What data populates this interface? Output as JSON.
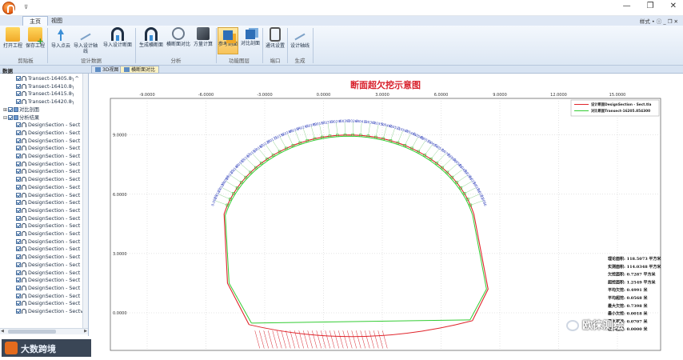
{
  "titlebar": {
    "qa_text": "⊽",
    "minimize": "—",
    "restore": "❐",
    "close": "✕"
  },
  "tabs": [
    {
      "label": "主页"
    },
    {
      "label": "视图"
    }
  ],
  "tab_right": "样式 • ⓘ _ ❐ ✕",
  "ribbon": {
    "buttons": [
      {
        "label": "打开工程"
      },
      {
        "label": "保存工程"
      },
      {
        "label": "导入点云"
      },
      {
        "label": "导入设计轴线"
      },
      {
        "label": "导入设计断面"
      },
      {
        "label": "生成横断面"
      },
      {
        "label": "横断面对比"
      },
      {
        "label": "方量计算"
      },
      {
        "label": "参考剖面"
      },
      {
        "label": "对比剖面"
      },
      {
        "label": "通讯设置"
      },
      {
        "label": "设计轴线"
      }
    ],
    "groups": [
      {
        "label": "剪贴板"
      },
      {
        "label": "设计数据"
      },
      {
        "label": "分析"
      },
      {
        "label": "功能图层"
      },
      {
        "label": "端口"
      },
      {
        "label": "生成"
      }
    ]
  },
  "panel": {
    "title": "数据"
  },
  "doc_tabs": [
    {
      "label": "3D视图"
    },
    {
      "label": "横断面对比"
    }
  ],
  "tree": {
    "items": [
      {
        "label": "Transect-16405.8╮^"
      },
      {
        "label": "Transect-16410.8╮"
      },
      {
        "label": "Transect-16415.8╮"
      },
      {
        "label": "Transect-16420.8╮"
      },
      {
        "label": "对比剖面"
      },
      {
        "label": "分析结果"
      },
      {
        "label": "DesignSection - Sect"
      },
      {
        "label": "DesignSection - Sect"
      },
      {
        "label": "DesignSection - Sect"
      },
      {
        "label": "DesignSection - Sect"
      },
      {
        "label": "DesignSection - Sect"
      },
      {
        "label": "DesignSection - Sect"
      },
      {
        "label": "DesignSection - Sect"
      },
      {
        "label": "DesignSection - Sect"
      },
      {
        "label": "DesignSection - Sect"
      },
      {
        "label": "DesignSection - Sect"
      },
      {
        "label": "DesignSection - Sect"
      },
      {
        "label": "DesignSection - Sect"
      },
      {
        "label": "DesignSection - Sect"
      },
      {
        "label": "DesignSection - Sect"
      },
      {
        "label": "DesignSection - Sect"
      },
      {
        "label": "DesignSection - Sect"
      },
      {
        "label": "DesignSection - Sect"
      },
      {
        "label": "DesignSection - Sect"
      },
      {
        "label": "DesignSection - Sect"
      },
      {
        "label": "DesignSection - Sect"
      },
      {
        "label": "DesignSection - Sect"
      },
      {
        "label": "DesignSection - Sect"
      },
      {
        "label": "DesignSection - Sect"
      },
      {
        "label": "DesignSection - Sect"
      },
      {
        "label": "DesignSection - Sectv"
      }
    ]
  },
  "side_logo": {
    "text": "大数跨境"
  },
  "chart": {
    "title": "断面超欠挖示意图",
    "x_ticks": [
      "-9.0000",
      "-6.0000",
      "-3.0000",
      "0.0000",
      "3.0000",
      "6.0000",
      "9.0000",
      "12.0000",
      "15.0000"
    ],
    "y_ticks": [
      "9.0000",
      "6.0000",
      "3.0000",
      "0.0000"
    ],
    "legend": [
      {
        "label": "设计断面DesignSection - Sect.tla",
        "color": "#e0242b"
      },
      {
        "label": "对比断面Transect-16205.854300",
        "color": "#33cc33"
      }
    ],
    "stats": [
      {
        "label": "理论面积: 118.5073 平方米"
      },
      {
        "label": "实测面积: 114.0348 平方米"
      },
      {
        "label": "欠挖面积: 0.7287 平方米"
      },
      {
        "label": "超挖面积: 1.2549 平方米"
      },
      {
        "label": "平均欠挖: 0.4991 米"
      },
      {
        "label": "平均超挖: 0.0568 米"
      },
      {
        "label": "最大欠挖: 0.7398 米"
      },
      {
        "label": "最小欠挖: 0.0018 米"
      },
      {
        "label": "最大超挖: 0.0707 米"
      },
      {
        "label": "最小超挖: 0.0000 米"
      }
    ],
    "arch_labels": [
      "0.0070",
      "0.0115",
      "0.0136",
      "0.0096",
      "0.0125",
      "0.0146",
      "0.0105",
      "0.0167",
      "0.0153",
      "0.0182",
      "0.0138",
      "0.0171",
      "0.0152",
      "0.0188",
      "0.0164",
      "0.0243",
      "0.0280",
      "0.0187",
      "0.0319",
      "0.0240",
      "0.0392",
      "0.0264",
      "0.0413",
      "0.0302",
      "0.0350",
      "0.0486",
      "0.0521",
      "0.0507",
      "0.0465",
      "0.0588",
      "0.0519",
      "0.0654",
      "0.0577",
      "0.0701",
      "0.0600",
      "0.0585",
      "0.0420",
      "0.0289",
      "0.0210",
      "0.0159",
      "0.0103",
      "0.0086"
    ],
    "colors": {
      "design": "#e0242b",
      "measured": "#33cc33",
      "labels": "#2a3bb8",
      "red_labels": "#d8212c"
    }
  },
  "watermark": {
    "text": "欧徕测绘"
  }
}
